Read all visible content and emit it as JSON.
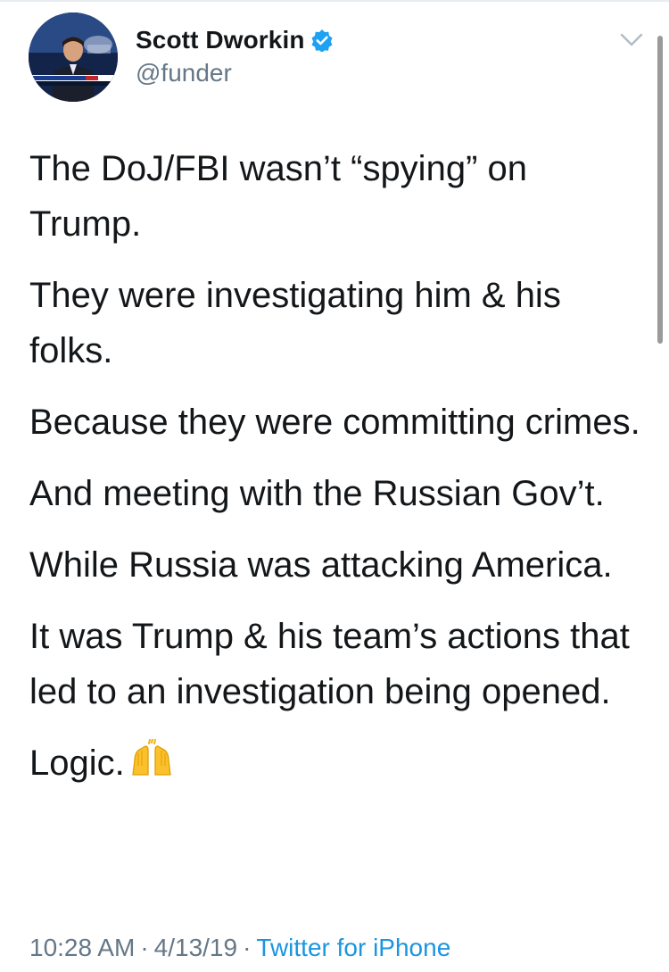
{
  "tweet": {
    "author": {
      "display_name": "Scott Dworkin",
      "handle": "@funder",
      "verified_icon": "verified-badge-icon",
      "avatar_icon": "profile-avatar"
    },
    "paragraphs": [
      "The DoJ/FBI wasn’t “spying” on Trump.",
      "They were investigating him & his folks.",
      "Because they were committing crimes.",
      "And meeting with the Russian Gov’t.",
      "While Russia was attacking America.",
      "It was Trump & his team’s actions that led to an investigation being opened.",
      "Logic."
    ],
    "emoji": "raising-hands-emoji",
    "time": "10:28 AM",
    "separator": "·",
    "date": "4/13/19",
    "source": "Twitter for iPhone"
  },
  "colors": {
    "text": "#14171a",
    "secondary": "#657786",
    "link": "#1b95e0",
    "verified": "#1da1f2"
  }
}
